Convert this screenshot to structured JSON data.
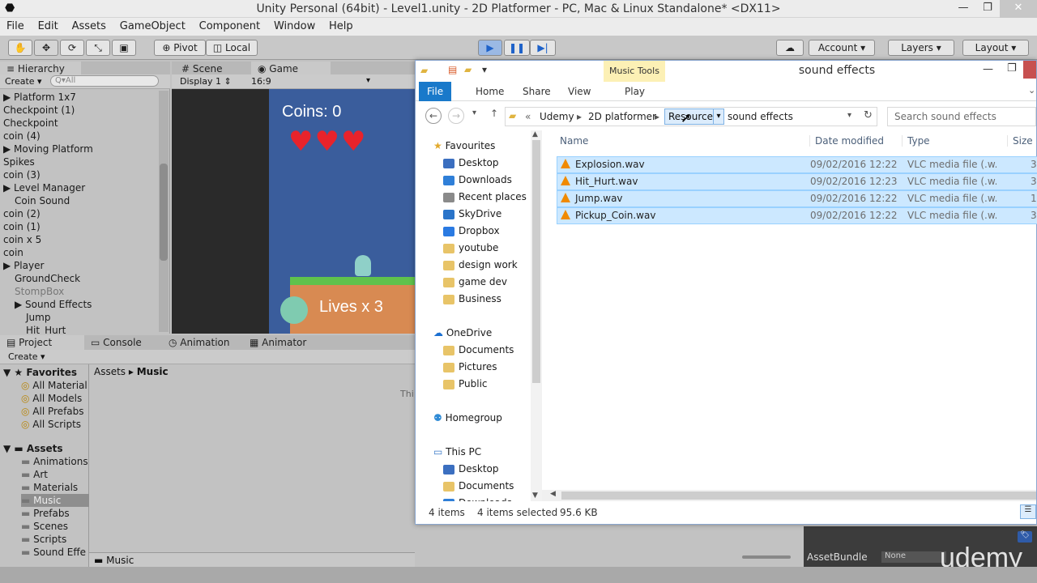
{
  "window": {
    "title": "Unity Personal (64bit) - Level1.unity - 2D Platformer - PC, Mac & Linux Standalone* <DX11>"
  },
  "menu": [
    "File",
    "Edit",
    "Assets",
    "GameObject",
    "Component",
    "Window",
    "Help"
  ],
  "toolbar": {
    "pivot": "Pivot",
    "local": "Local",
    "account": "Account",
    "layers": "Layers",
    "layout": "Layout"
  },
  "hierarchy": {
    "tab": "Hierarchy",
    "create": "Create",
    "search_placeholder": "Q▾All",
    "items": [
      {
        "label": "Platform 1x7",
        "indent": 0,
        "arrow": true
      },
      {
        "label": "Checkpoint (1)",
        "indent": 0,
        "arrow": false
      },
      {
        "label": "Checkpoint",
        "indent": 0,
        "arrow": false
      },
      {
        "label": "coin (4)",
        "indent": 0,
        "arrow": false
      },
      {
        "label": "Moving Platform",
        "indent": 0,
        "arrow": true
      },
      {
        "label": "Spikes",
        "indent": 0,
        "arrow": false
      },
      {
        "label": "coin (3)",
        "indent": 0,
        "arrow": false
      },
      {
        "label": "Level Manager",
        "indent": 0,
        "arrow": true
      },
      {
        "label": "Coin Sound",
        "indent": 1,
        "arrow": false
      },
      {
        "label": "coin (2)",
        "indent": 0,
        "arrow": false
      },
      {
        "label": "coin (1)",
        "indent": 0,
        "arrow": false
      },
      {
        "label": "coin x 5",
        "indent": 0,
        "arrow": false
      },
      {
        "label": "coin",
        "indent": 0,
        "arrow": false
      },
      {
        "label": "Player",
        "indent": 0,
        "arrow": true
      },
      {
        "label": "GroundCheck",
        "indent": 1,
        "arrow": false
      },
      {
        "label": "StompBox",
        "indent": 1,
        "arrow": false
      },
      {
        "label": "Sound Effects",
        "indent": 1,
        "arrow": true
      },
      {
        "label": "Jump",
        "indent": 2,
        "arrow": false
      },
      {
        "label": "Hit_Hurt",
        "indent": 2,
        "arrow": false
      }
    ]
  },
  "scene": {
    "tab_scene": "Scene",
    "tab_game": "Game",
    "display": "Display 1",
    "aspect": "16:9",
    "coins": "Coins: 0",
    "lives": "Lives x 3"
  },
  "bottom_tabs": {
    "project": "Project",
    "console": "Console",
    "animation": "Animation",
    "animator": "Animator"
  },
  "project": {
    "create": "Create",
    "breadcrumb_root": "Assets",
    "breadcrumb_current": "Music",
    "favorites_label": "Favorites",
    "favorites": [
      "All Material",
      "All Models",
      "All Prefabs",
      "All Scripts"
    ],
    "assets_label": "Assets",
    "folders": [
      "Animations",
      "Art",
      "Materials",
      "Music",
      "Prefabs",
      "Scenes",
      "Scripts",
      "Sound Effe"
    ],
    "selected_folder": "Music",
    "footer": "Music",
    "empty_hint": "Thi"
  },
  "inspector": {
    "assetbundle": "AssetBundle",
    "none": "None"
  },
  "explorer": {
    "title": "sound effects",
    "contextual": "Music Tools",
    "ribbon": [
      "File",
      "Home",
      "Share",
      "View",
      "Play"
    ],
    "crumbs": [
      "«",
      "Udemy",
      "2D platformer",
      "Resources",
      "sound effects"
    ],
    "search_placeholder": "Search sound effects",
    "nav": {
      "favourites": "Favourites",
      "fav_items": [
        "Desktop",
        "Downloads",
        "Recent places",
        "SkyDrive",
        "Dropbox",
        "youtube",
        "design work",
        "game dev",
        "Business"
      ],
      "onedrive": "OneDrive",
      "od_items": [
        "Documents",
        "Pictures",
        "Public"
      ],
      "homegroup": "Homegroup",
      "thispc": "This PC",
      "pc_items": [
        "Desktop",
        "Documents",
        "Downloads"
      ]
    },
    "columns": {
      "name": "Name",
      "date": "Date modified",
      "type": "Type",
      "size": "Size"
    },
    "files": [
      {
        "name": "Explosion.wav",
        "date": "09/02/2016 12:22",
        "type": "VLC media file (.w...",
        "size": "3"
      },
      {
        "name": "Hit_Hurt.wav",
        "date": "09/02/2016 12:23",
        "type": "VLC media file (.w...",
        "size": "3"
      },
      {
        "name": "Jump.wav",
        "date": "09/02/2016 12:22",
        "type": "VLC media file (.w...",
        "size": "1"
      },
      {
        "name": "Pickup_Coin.wav",
        "date": "09/02/2016 12:22",
        "type": "VLC media file (.w...",
        "size": "3"
      }
    ],
    "status": {
      "count": "4 items",
      "selected": "4 items selected",
      "size": "95.6 KB"
    }
  },
  "watermark": "udemy"
}
